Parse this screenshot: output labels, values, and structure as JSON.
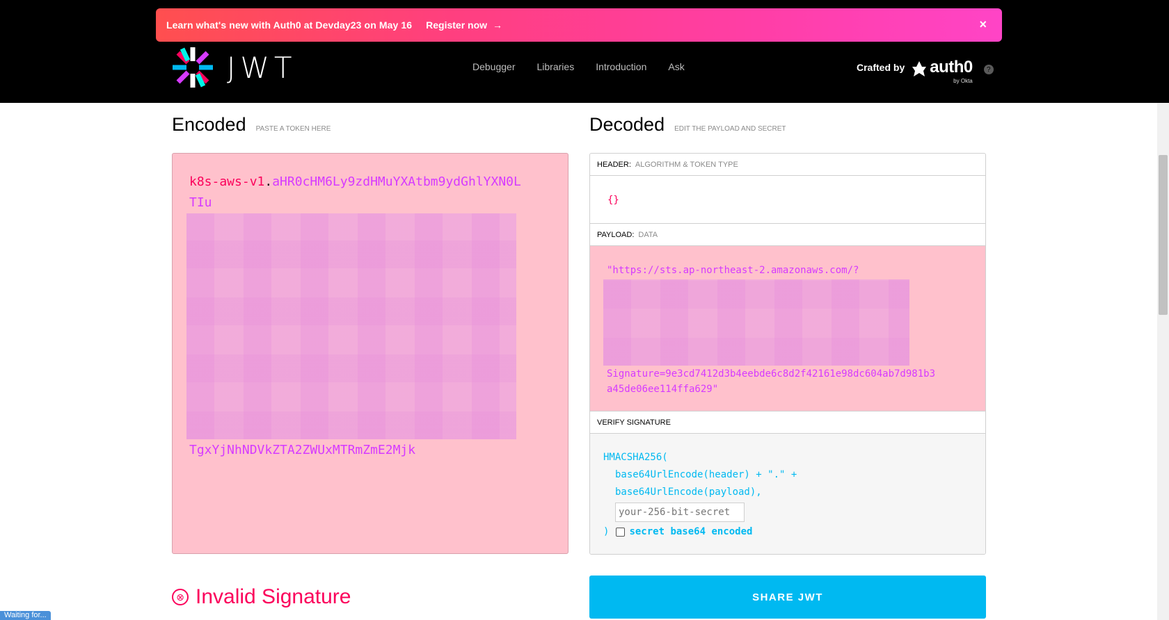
{
  "banner": {
    "message": "Learn what's new with Auth0 at Devday23 on May 16",
    "cta": "Register now",
    "cta_arrow": "→",
    "close": "×"
  },
  "logo": {
    "wordmark": "JWT"
  },
  "nav": [
    "Debugger",
    "Libraries",
    "Introduction",
    "Ask"
  ],
  "crafted": {
    "prefix": "Crafted by",
    "brand": "auth0",
    "sub": "by Okta",
    "help": "?"
  },
  "encoded": {
    "title": "Encoded",
    "subtitle": "PASTE A TOKEN HERE",
    "header_part": "k8s-aws-v1",
    "dot": ".",
    "payload_part": "aHR0cHM6Ly9zdHMuYXAtbm9ydGhlYXN0LTIu",
    "tail": "TgxYjNhNDVkZTA2ZWUxMTRmZmE2Mjk"
  },
  "decoded": {
    "title": "Decoded",
    "subtitle": "EDIT THE PAYLOAD AND SECRET",
    "header_label": "HEADER:",
    "header_desc": "ALGORITHM & TOKEN TYPE",
    "header_json": "{}",
    "payload_label": "PAYLOAD:",
    "payload_desc": "DATA",
    "payload_line1": "\"https://sts.ap-northeast-2.amazonaws.com/?",
    "payload_signature": "Signature=9e3cd7412d3b4eebde6c8d2f42161e98dc604ab7d981b3a45de06ee114ffa629\"",
    "verify_label": "VERIFY SIGNATURE",
    "verify_fn": "HMACSHA256(",
    "verify_line2": "base64UrlEncode(header) + \".\" +",
    "verify_line3": "base64UrlEncode(payload),",
    "secret_placeholder": "your-256-bit-secret",
    "close_paren": ")",
    "b64_label": "secret base64 encoded"
  },
  "result": {
    "icon": "⊗",
    "text": "Invalid Signature"
  },
  "share_label": "SHARE JWT",
  "status_text": "Waiting for..."
}
